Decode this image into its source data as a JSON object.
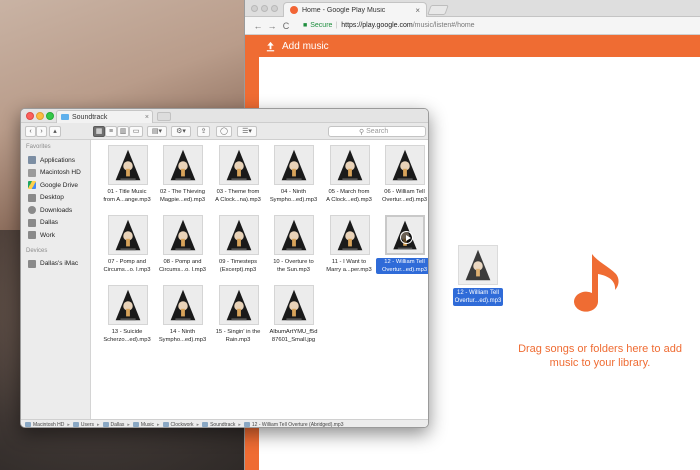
{
  "chrome": {
    "tab_title": "Home - Google Play Music",
    "tab_close": "×",
    "nav_back": "←",
    "nav_forward": "→",
    "nav_reload": "C",
    "secure_label": "Secure",
    "url_host": "https://play.google.com",
    "url_path": "/music/listen#/home"
  },
  "gpm": {
    "add_music_label": "Add music",
    "drop_text": "Drag songs or folders here to add music to your library.",
    "drag_ghost_label": "12 - William Tell\nOvertur...ed).mp3",
    "accent_color": "#ef6c33"
  },
  "finder": {
    "tab_title": "Soundtrack",
    "tab_close": "×",
    "search_placeholder": "Search",
    "sidebar": {
      "favorites_heading": "Favorites",
      "favorites": [
        {
          "label": "Applications",
          "icon": "applications-icon"
        },
        {
          "label": "Macintosh HD",
          "icon": "hard-drive-icon"
        },
        {
          "label": "Google Drive",
          "icon": "google-drive-icon"
        },
        {
          "label": "Desktop",
          "icon": "desktop-icon"
        },
        {
          "label": "Downloads",
          "icon": "downloads-icon"
        },
        {
          "label": "Dallas",
          "icon": "home-icon"
        },
        {
          "label": "Work",
          "icon": "folder-icon"
        }
      ],
      "devices_heading": "Devices",
      "devices": [
        {
          "label": "Dallas's iMac",
          "icon": "imac-icon"
        }
      ]
    },
    "files": [
      {
        "label": "01 - Title Music\nfrom A...ange.mp3"
      },
      {
        "label": "02 - The Thieving\nMagpie...ed).mp3"
      },
      {
        "label": "03 - Theme from\nA Clock...na).mp3"
      },
      {
        "label": "04 - Ninth\nSympho...ed).mp3"
      },
      {
        "label": "05 - March from\nA Clock...ed).mp3"
      },
      {
        "label": "06 - William Tell\nOvertur...ed).mp3"
      },
      {
        "label": "07 - Pomp and\nCircums...o. I.mp3"
      },
      {
        "label": "08 - Pomp and\nCircums...o. I.mp3"
      },
      {
        "label": "09 - Timesteps\n(Excerpt).mp3"
      },
      {
        "label": "10 - Overture to\nthe Sun.mp3"
      },
      {
        "label": "11 - I Want to\nMarry a...per.mp3"
      },
      {
        "label": "12 - William Tell\nOvertur...ed).mp3",
        "selected": true
      },
      {
        "label": "13 - Suicide\nScherzo...ed).mp3"
      },
      {
        "label": "14 - Ninth\nSympho...ed).mp3"
      },
      {
        "label": "15 - Singin' in the\nRain.mp3"
      },
      {
        "label": "AlbumArtYMU_f5d\n87601_Small.jpg"
      }
    ],
    "pathbar": [
      "Macintosh HD",
      "Users",
      "Dallas",
      "Music",
      "Clockwork",
      "Soundtrack",
      "12 - William Tell Overture (Abridged).mp3"
    ],
    "pathbar_sep": "▸"
  }
}
